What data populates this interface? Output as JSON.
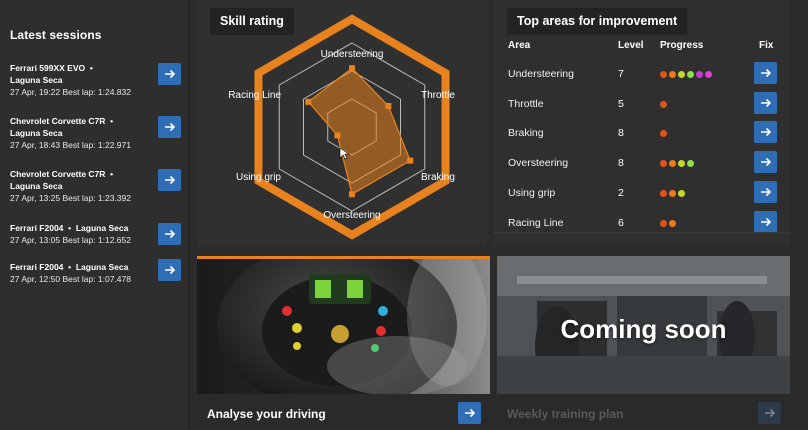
{
  "sidebar": {
    "title": "Latest sessions",
    "sessions": [
      {
        "car": "Ferrari 599XX EVO",
        "track": "Laguna Seca",
        "sep": "•",
        "details": "27 Apr, 19:22 Best lap: 1:24.832"
      },
      {
        "car": "Chevrolet Corvette C7R",
        "track": "Laguna Seca",
        "sep": "•",
        "details": "27 Apr, 18:43 Best lap: 1:22.971"
      },
      {
        "car": "Chevrolet Corvette C7R",
        "track": "Laguna Seca",
        "sep": "•",
        "details": "27 Apr, 13:25 Best lap: 1:23.392"
      },
      {
        "car": "Ferrari F2004",
        "track": "Laguna Seca",
        "sep": "•",
        "details": "27 Apr, 13:05 Best lap: 1:12.652"
      },
      {
        "car": "Ferrari F2004",
        "track": "Laguna Seca",
        "sep": "•",
        "details": "27 Apr, 12:50 Best lap: 1:07.478"
      }
    ]
  },
  "skill": {
    "title": "Skill rating",
    "axes": [
      "Understeering",
      "Throttle",
      "Braking",
      "Oversteering",
      "Using grip",
      "Racing Line"
    ],
    "values": [
      7,
      5,
      8,
      8,
      2,
      6
    ],
    "max": 10,
    "accent": "#e8821e"
  },
  "improve": {
    "title": "Top areas for improvement",
    "headers": {
      "area": "Area",
      "level": "Level",
      "progress": "Progress",
      "fix": "Fix"
    },
    "rows": [
      {
        "area": "Understeering",
        "level": "7",
        "dots": [
          "#e0541c",
          "#f07a1a",
          "#c8d62a",
          "#8ee04a",
          "#c43ccf",
          "#e03fd8"
        ]
      },
      {
        "area": "Throttle",
        "level": "5",
        "dots": [
          "#e0541c"
        ]
      },
      {
        "area": "Braking",
        "level": "8",
        "dots": [
          "#e0541c"
        ]
      },
      {
        "area": "Oversteering",
        "level": "8",
        "dots": [
          "#e0541c",
          "#f07a1a",
          "#c8d62a",
          "#8ee04a"
        ]
      },
      {
        "area": "Using grip",
        "level": "2",
        "dots": [
          "#e0541c",
          "#f07a1a",
          "#c8d62a"
        ]
      },
      {
        "area": "Racing Line",
        "level": "6",
        "dots": [
          "#e0541c",
          "#f07a1a"
        ]
      }
    ]
  },
  "cards": {
    "analyse": {
      "label": "Analyse your driving"
    },
    "training": {
      "label": "Weekly training plan",
      "overlay": "Coming soon"
    }
  },
  "icons": {
    "arrow": "arrow-right-icon"
  },
  "colors": {
    "button": "#2f6db5",
    "accent": "#e8821e"
  }
}
